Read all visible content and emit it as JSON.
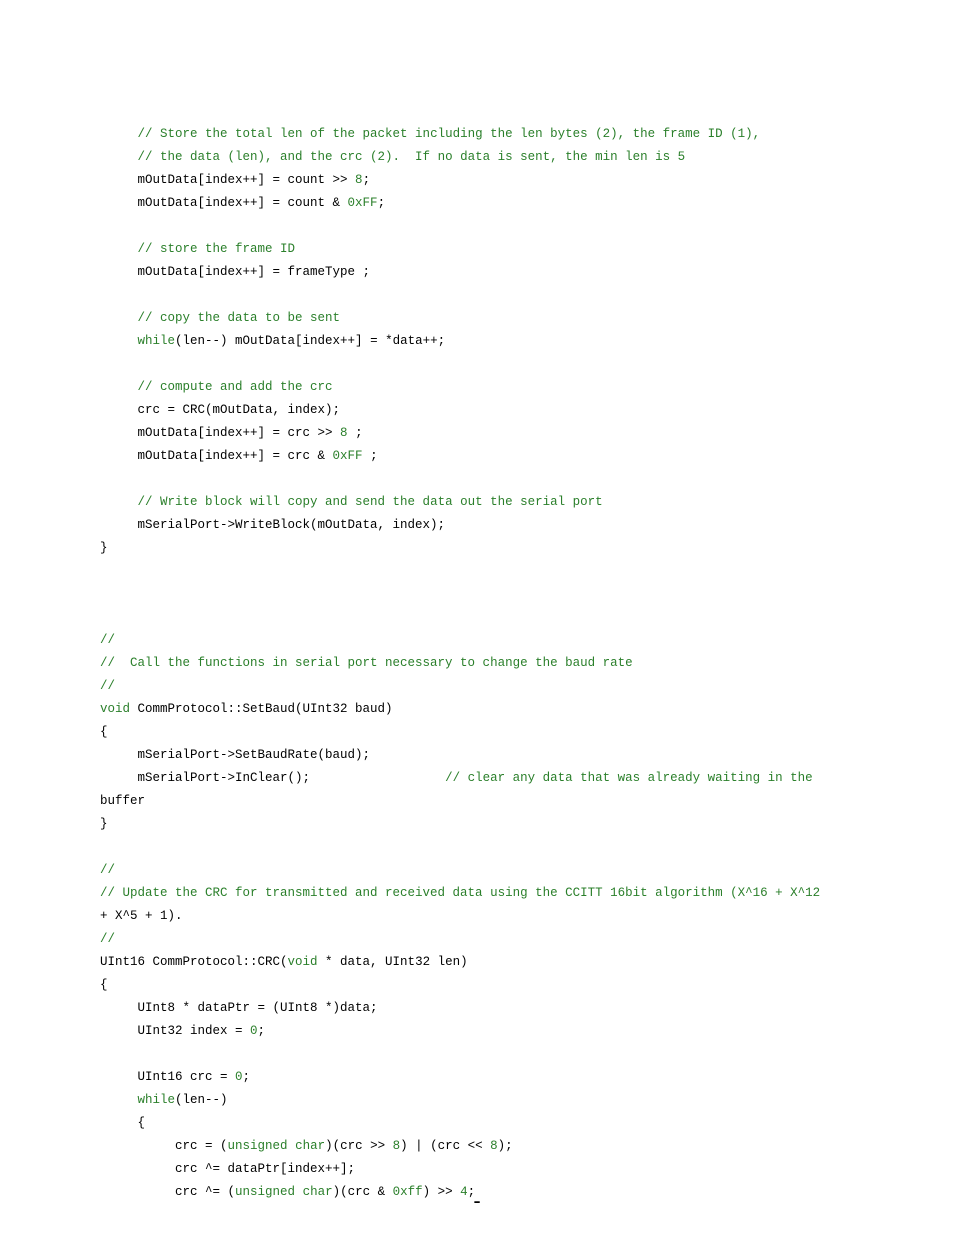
{
  "lines": [
    [
      {
        "cls": "plain",
        "txt": ""
      }
    ],
    [
      {
        "cls": "plain",
        "txt": "     "
      },
      {
        "cls": "cmt",
        "txt": "// Store the total len of the packet including the len bytes (2), the frame ID (1),"
      }
    ],
    [
      {
        "cls": "plain",
        "txt": "     "
      },
      {
        "cls": "cmt",
        "txt": "// the data (len), and the crc (2).  If no data is sent, the min len is 5"
      }
    ],
    [
      {
        "cls": "plain",
        "txt": "     mOutData[index++] = count >> "
      },
      {
        "cls": "num",
        "txt": "8"
      },
      {
        "cls": "plain",
        "txt": ";"
      }
    ],
    [
      {
        "cls": "plain",
        "txt": "     mOutData[index++] = count & "
      },
      {
        "cls": "num",
        "txt": "0xFF"
      },
      {
        "cls": "plain",
        "txt": ";"
      }
    ],
    [
      {
        "cls": "plain",
        "txt": ""
      }
    ],
    [
      {
        "cls": "plain",
        "txt": "     "
      },
      {
        "cls": "cmt",
        "txt": "// store the frame ID"
      }
    ],
    [
      {
        "cls": "plain",
        "txt": "     mOutData[index++] = frameType ;"
      }
    ],
    [
      {
        "cls": "plain",
        "txt": ""
      }
    ],
    [
      {
        "cls": "plain",
        "txt": "     "
      },
      {
        "cls": "cmt",
        "txt": "// copy the data to be sent"
      }
    ],
    [
      {
        "cls": "plain",
        "txt": "     "
      },
      {
        "cls": "kw",
        "txt": "while"
      },
      {
        "cls": "plain",
        "txt": "(len--) mOutData[index++] = *data++;"
      }
    ],
    [
      {
        "cls": "plain",
        "txt": ""
      }
    ],
    [
      {
        "cls": "plain",
        "txt": "     "
      },
      {
        "cls": "cmt",
        "txt": "// compute and add the crc"
      }
    ],
    [
      {
        "cls": "plain",
        "txt": "     crc = CRC(mOutData, index);"
      }
    ],
    [
      {
        "cls": "plain",
        "txt": "     mOutData[index++] = crc >> "
      },
      {
        "cls": "num",
        "txt": "8"
      },
      {
        "cls": "plain",
        "txt": " ;"
      }
    ],
    [
      {
        "cls": "plain",
        "txt": "     mOutData[index++] = crc & "
      },
      {
        "cls": "num",
        "txt": "0xFF"
      },
      {
        "cls": "plain",
        "txt": " ;"
      }
    ],
    [
      {
        "cls": "plain",
        "txt": ""
      }
    ],
    [
      {
        "cls": "plain",
        "txt": "     "
      },
      {
        "cls": "cmt",
        "txt": "// Write block will copy and send the data out the serial port"
      }
    ],
    [
      {
        "cls": "plain",
        "txt": "     mSerialPort->WriteBlock(mOutData, index);"
      }
    ],
    [
      {
        "cls": "plain",
        "txt": "}"
      }
    ],
    [
      {
        "cls": "plain",
        "txt": ""
      }
    ],
    [
      {
        "cls": "plain",
        "txt": ""
      }
    ],
    [
      {
        "cls": "plain",
        "txt": ""
      }
    ],
    [
      {
        "cls": "cmt",
        "txt": "//"
      }
    ],
    [
      {
        "cls": "cmt",
        "txt": "//  Call the functions in serial port necessary to change the baud rate"
      }
    ],
    [
      {
        "cls": "cmt",
        "txt": "//"
      }
    ],
    [
      {
        "cls": "kw",
        "txt": "void"
      },
      {
        "cls": "plain",
        "txt": " CommProtocol::SetBaud(UInt32 baud)"
      }
    ],
    [
      {
        "cls": "plain",
        "txt": "{"
      }
    ],
    [
      {
        "cls": "plain",
        "txt": "     mSerialPort->SetBaudRate(baud);"
      }
    ],
    [
      {
        "cls": "plain",
        "txt": "     mSerialPort->InClear();                  "
      },
      {
        "cls": "cmt",
        "txt": "// clear any data that was already waiting in the "
      }
    ],
    [
      {
        "cls": "plain",
        "txt": "buffer"
      }
    ],
    [
      {
        "cls": "plain",
        "txt": "}"
      }
    ],
    [
      {
        "cls": "plain",
        "txt": ""
      }
    ],
    [
      {
        "cls": "cmt",
        "txt": "//"
      }
    ],
    [
      {
        "cls": "cmt",
        "txt": "// Update the CRC for transmitted and received data using the CCITT 16bit algorithm (X^16 + X^12 "
      }
    ],
    [
      {
        "cls": "plain",
        "txt": "+ X^5 + 1)."
      }
    ],
    [
      {
        "cls": "cmt",
        "txt": "//"
      }
    ],
    [
      {
        "cls": "plain",
        "txt": "UInt16 CommProtocol::CRC("
      },
      {
        "cls": "kw",
        "txt": "void"
      },
      {
        "cls": "plain",
        "txt": " * data, UInt32 len)"
      }
    ],
    [
      {
        "cls": "plain",
        "txt": "{"
      }
    ],
    [
      {
        "cls": "plain",
        "txt": "     UInt8 * dataPtr = (UInt8 *)data;"
      }
    ],
    [
      {
        "cls": "plain",
        "txt": "     UInt32 index = "
      },
      {
        "cls": "num",
        "txt": "0"
      },
      {
        "cls": "plain",
        "txt": ";"
      }
    ],
    [
      {
        "cls": "plain",
        "txt": ""
      }
    ],
    [
      {
        "cls": "plain",
        "txt": "     UInt16 crc = "
      },
      {
        "cls": "num",
        "txt": "0"
      },
      {
        "cls": "plain",
        "txt": ";"
      }
    ],
    [
      {
        "cls": "plain",
        "txt": "     "
      },
      {
        "cls": "kw",
        "txt": "while"
      },
      {
        "cls": "plain",
        "txt": "(len--)"
      }
    ],
    [
      {
        "cls": "plain",
        "txt": "     {"
      }
    ],
    [
      {
        "cls": "plain",
        "txt": "          crc = ("
      },
      {
        "cls": "kw",
        "txt": "unsigned"
      },
      {
        "cls": "plain",
        "txt": " "
      },
      {
        "cls": "kw",
        "txt": "char"
      },
      {
        "cls": "plain",
        "txt": ")(crc >> "
      },
      {
        "cls": "num",
        "txt": "8"
      },
      {
        "cls": "plain",
        "txt": ") | (crc << "
      },
      {
        "cls": "num",
        "txt": "8"
      },
      {
        "cls": "plain",
        "txt": ");"
      }
    ],
    [
      {
        "cls": "plain",
        "txt": "          crc ^= dataPtr[index++];"
      }
    ],
    [
      {
        "cls": "plain",
        "txt": "          crc ^= ("
      },
      {
        "cls": "kw",
        "txt": "unsigned"
      },
      {
        "cls": "plain",
        "txt": " "
      },
      {
        "cls": "kw",
        "txt": "char"
      },
      {
        "cls": "plain",
        "txt": ")(crc & "
      },
      {
        "cls": "num",
        "txt": "0xff"
      },
      {
        "cls": "plain",
        "txt": ") >> "
      },
      {
        "cls": "num",
        "txt": "4"
      },
      {
        "cls": "plain",
        "txt": ";"
      }
    ]
  ],
  "footer": "-"
}
